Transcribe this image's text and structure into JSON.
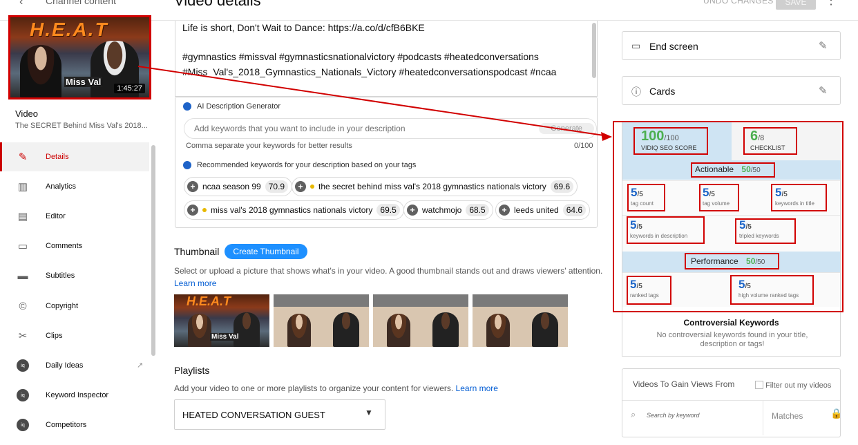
{
  "header": {
    "channel_title": "Channel content",
    "page_title": "Video details",
    "undo_label": "UNDO CHANGES",
    "save_label": "SAVE"
  },
  "sidebar": {
    "thumbnail_title": "H.E.A.T",
    "thumbnail_name": "Miss Val",
    "thumbnail_duration": "1:45:27",
    "video_label": "Video",
    "video_title": "The SECRET Behind Miss Val's 2018...",
    "items": [
      {
        "label": "Details",
        "icon": "pencil-icon",
        "active": true
      },
      {
        "label": "Analytics",
        "icon": "analytics-icon"
      },
      {
        "label": "Editor",
        "icon": "editor-icon"
      },
      {
        "label": "Comments",
        "icon": "comments-icon"
      },
      {
        "label": "Subtitles",
        "icon": "subtitles-icon"
      },
      {
        "label": "Copyright",
        "icon": "copyright-icon"
      },
      {
        "label": "Clips",
        "icon": "scissors-icon"
      },
      {
        "label": "Daily Ideas",
        "icon": "vidiq-icon"
      },
      {
        "label": "Keyword Inspector",
        "icon": "vidiq-icon"
      },
      {
        "label": "Competitors",
        "icon": "vidiq-icon"
      }
    ]
  },
  "description": {
    "line1": "Life is short, Don't Wait to Dance: https://a.co/d/cfB6BKE",
    "line2": "#gymnastics #missval #gymnasticsnationalvictory #podcasts #heatedconversations",
    "line3": "#Miss_Val's_2018_Gymnastics_Nationals_Victory #heatedconversationspodcast #ncaa"
  },
  "ai_generator": {
    "title": "AI Description Generator",
    "placeholder": "Add keywords that you want to include in your description",
    "generate_label": "Generate",
    "hint": "Comma separate your keywords for better results",
    "count": "0/100",
    "recommended_title": "Recommended keywords for your description based on your tags",
    "chips": [
      {
        "label": "ncaa season 99",
        "score": "70.9",
        "dot": false
      },
      {
        "label": "the secret behind miss val's 2018 gymnastics nationals victory",
        "score": "69.6",
        "dot": true
      },
      {
        "label": "miss val's 2018 gymnastics nationals victory",
        "score": "69.5",
        "dot": true
      },
      {
        "label": "watchmojo",
        "score": "68.5",
        "dot": false
      },
      {
        "label": "leeds united",
        "score": "64.6",
        "dot": false
      }
    ]
  },
  "thumbnail_section": {
    "title": "Thumbnail",
    "create_label": "Create Thumbnail",
    "description": "Select or upload a picture that shows what's in your video. A good thumbnail stands out and draws viewers' attention.",
    "learn_more": "Learn more"
  },
  "playlists": {
    "title": "Playlists",
    "description": "Add your video to one or more playlists to organize your content for viewers.",
    "learn_more": "Learn more",
    "selected": "HEATED CONVERSATION GUEST"
  },
  "right_panel": {
    "end_screen_label": "End screen",
    "cards_label": "Cards",
    "seo_score": "100",
    "seo_score_max": "/100",
    "seo_label": "VIDIQ SEO SCORE",
    "checklist_score": "6",
    "checklist_max": "/8",
    "checklist_label": "CHECKLIST",
    "actionable_label": "Actionable",
    "actionable_score": "50",
    "actionable_max": "/50",
    "performance_label": "Performance",
    "performance_score": "50",
    "performance_max": "/50",
    "metrics": [
      {
        "value": "5",
        "max": "/5",
        "label": "tag count"
      },
      {
        "value": "5",
        "max": "/5",
        "label": "tag volume"
      },
      {
        "value": "5",
        "max": "/5",
        "label": "keywords in title"
      },
      {
        "value": "5",
        "max": "/5",
        "label": "keywords in description"
      },
      {
        "value": "5",
        "max": "/5",
        "label": "tripled keywords"
      },
      {
        "value": "5",
        "max": "/5",
        "label": "ranked tags"
      },
      {
        "value": "5",
        "max": "/5",
        "label": "high volume ranked tags"
      }
    ],
    "controversial_title": "Controversial Keywords",
    "controversial_desc": "No controversial keywords found in your title, description or tags!",
    "videos_title": "Videos To Gain Views From",
    "filter_label": "Filter out my videos",
    "search_placeholder": "Search by keyword",
    "matches_label": "Matches"
  },
  "colors": {
    "accent_red": "#cc0000",
    "annotation_red": "#d10000",
    "vidiq_blue": "#1e66c8",
    "score_green": "#4caf50",
    "button_blue": "#1e90ff"
  }
}
